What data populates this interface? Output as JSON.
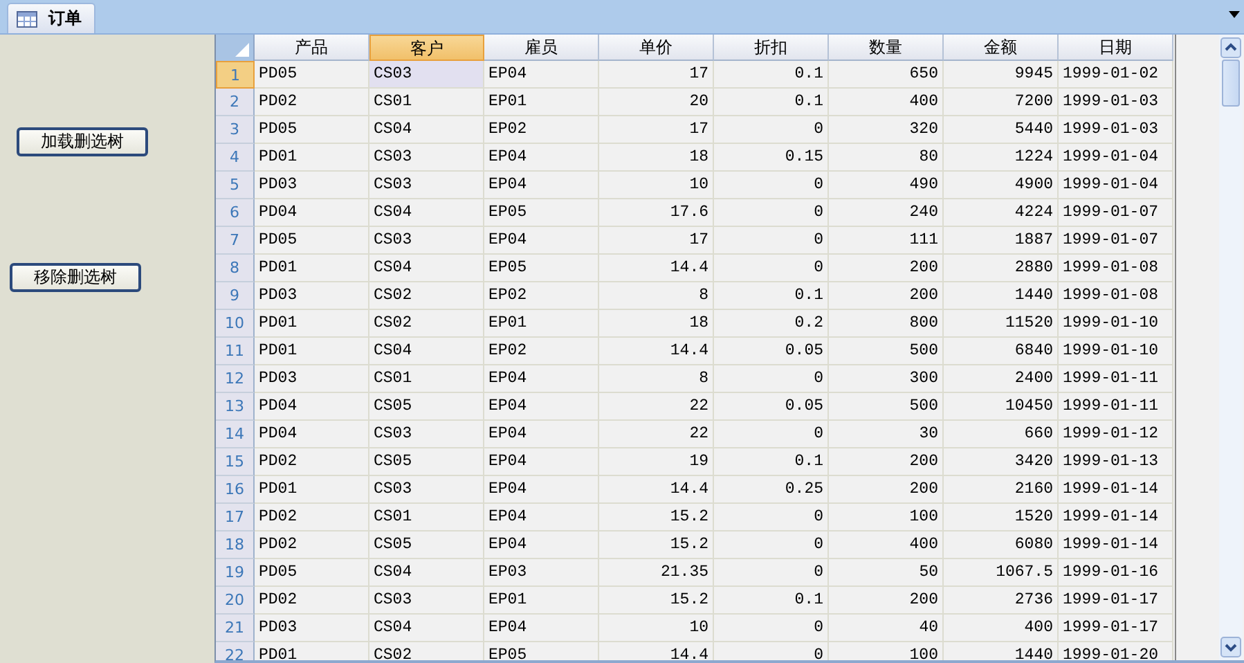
{
  "tabs": [
    {
      "label": "订单",
      "selected": true
    }
  ],
  "buttons": [
    "加载删选树",
    "移除删选树"
  ],
  "grid": {
    "columns": [
      {
        "label": "产品",
        "selected": false,
        "kind": "text"
      },
      {
        "label": "客户",
        "selected": true,
        "kind": "text"
      },
      {
        "label": "雇员",
        "selected": false,
        "kind": "text"
      },
      {
        "label": "单价",
        "selected": false,
        "kind": "number"
      },
      {
        "label": "折扣",
        "selected": false,
        "kind": "number"
      },
      {
        "label": "数量",
        "selected": false,
        "kind": "number"
      },
      {
        "label": "金额",
        "selected": false,
        "kind": "number"
      },
      {
        "label": "日期",
        "selected": false,
        "kind": "text"
      }
    ],
    "rows": [
      {
        "number": "1",
        "selected": true,
        "cells": [
          "PD05",
          "CS03",
          "EP04",
          "17",
          "0.1",
          "650",
          "9945",
          "1999-01-02"
        ]
      },
      {
        "number": "2",
        "selected": false,
        "cells": [
          "PD02",
          "CS01",
          "EP01",
          "20",
          "0.1",
          "400",
          "7200",
          "1999-01-03"
        ]
      },
      {
        "number": "3",
        "selected": false,
        "cells": [
          "PD05",
          "CS04",
          "EP02",
          "17",
          "0",
          "320",
          "5440",
          "1999-01-03"
        ]
      },
      {
        "number": "4",
        "selected": false,
        "cells": [
          "PD01",
          "CS03",
          "EP04",
          "18",
          "0.15",
          "80",
          "1224",
          "1999-01-04"
        ]
      },
      {
        "number": "5",
        "selected": false,
        "cells": [
          "PD03",
          "CS03",
          "EP04",
          "10",
          "0",
          "490",
          "4900",
          "1999-01-04"
        ]
      },
      {
        "number": "6",
        "selected": false,
        "cells": [
          "PD04",
          "CS04",
          "EP05",
          "17.6",
          "0",
          "240",
          "4224",
          "1999-01-07"
        ]
      },
      {
        "number": "7",
        "selected": false,
        "cells": [
          "PD05",
          "CS03",
          "EP04",
          "17",
          "0",
          "111",
          "1887",
          "1999-01-07"
        ]
      },
      {
        "number": "8",
        "selected": false,
        "cells": [
          "PD01",
          "CS04",
          "EP05",
          "14.4",
          "0",
          "200",
          "2880",
          "1999-01-08"
        ]
      },
      {
        "number": "9",
        "selected": false,
        "cells": [
          "PD03",
          "CS02",
          "EP02",
          "8",
          "0.1",
          "200",
          "1440",
          "1999-01-08"
        ]
      },
      {
        "number": "10",
        "selected": false,
        "cells": [
          "PD01",
          "CS02",
          "EP01",
          "18",
          "0.2",
          "800",
          "11520",
          "1999-01-10"
        ]
      },
      {
        "number": "11",
        "selected": false,
        "cells": [
          "PD01",
          "CS04",
          "EP02",
          "14.4",
          "0.05",
          "500",
          "6840",
          "1999-01-10"
        ]
      },
      {
        "number": "12",
        "selected": false,
        "cells": [
          "PD03",
          "CS01",
          "EP04",
          "8",
          "0",
          "300",
          "2400",
          "1999-01-11"
        ]
      },
      {
        "number": "13",
        "selected": false,
        "cells": [
          "PD04",
          "CS05",
          "EP04",
          "22",
          "0.05",
          "500",
          "10450",
          "1999-01-11"
        ]
      },
      {
        "number": "14",
        "selected": false,
        "cells": [
          "PD04",
          "CS03",
          "EP04",
          "22",
          "0",
          "30",
          "660",
          "1999-01-12"
        ]
      },
      {
        "number": "15",
        "selected": false,
        "cells": [
          "PD02",
          "CS05",
          "EP04",
          "19",
          "0.1",
          "200",
          "3420",
          "1999-01-13"
        ]
      },
      {
        "number": "16",
        "selected": false,
        "cells": [
          "PD01",
          "CS03",
          "EP04",
          "14.4",
          "0.25",
          "200",
          "2160",
          "1999-01-14"
        ]
      },
      {
        "number": "17",
        "selected": false,
        "cells": [
          "PD02",
          "CS01",
          "EP04",
          "15.2",
          "0",
          "100",
          "1520",
          "1999-01-14"
        ]
      },
      {
        "number": "18",
        "selected": false,
        "cells": [
          "PD02",
          "CS05",
          "EP04",
          "15.2",
          "0",
          "400",
          "6080",
          "1999-01-14"
        ]
      },
      {
        "number": "19",
        "selected": false,
        "cells": [
          "PD05",
          "CS04",
          "EP03",
          "21.35",
          "0",
          "50",
          "1067.5",
          "1999-01-16"
        ]
      },
      {
        "number": "20",
        "selected": false,
        "cells": [
          "PD02",
          "CS03",
          "EP01",
          "15.2",
          "0.1",
          "200",
          "2736",
          "1999-01-17"
        ]
      },
      {
        "number": "21",
        "selected": false,
        "cells": [
          "PD03",
          "CS04",
          "EP04",
          "10",
          "0",
          "40",
          "400",
          "1999-01-17"
        ]
      },
      {
        "number": "22",
        "selected": false,
        "cells": [
          "PD01",
          "CS02",
          "EP05",
          "14.4",
          "0",
          "100",
          "1440",
          "1999-01-20"
        ]
      }
    ]
  }
}
